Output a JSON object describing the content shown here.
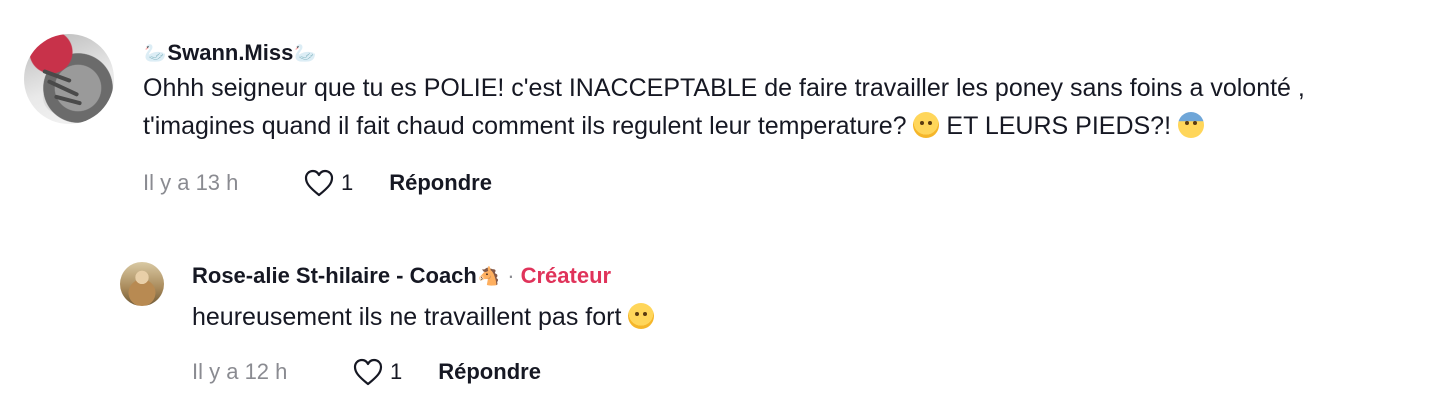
{
  "comments": [
    {
      "username": "Swann.Miss",
      "name_prefix_icon": "swan-icon",
      "name_suffix_icon": "swan-icon",
      "text_part1": "Ohhh seigneur que tu es POLIE! c'est INACCEPTABLE de faire travailler les poney sans foins a volonté , t'imagines quand il fait chaud comment ils regulent leur temperature? ",
      "emoji1": "pleading-face-emoji",
      "text_part2": " ET LEURS PIEDS?! ",
      "emoji2": "anxious-sweat-face-emoji",
      "time": "Il y a 13 h",
      "likes": "1",
      "reply_label": "Répondre"
    },
    {
      "username": "Rose-alie St-hilaire - Coach",
      "name_suffix_icon": "horse-icon",
      "separator": "·",
      "badge": "Créateur",
      "text": "heureusement ils ne travaillent pas fort ",
      "emoji": "smiling-face-emoji",
      "time": "Il y a 12 h",
      "likes": "1",
      "reply_label": "Répondre"
    }
  ],
  "colors": {
    "text": "#161823",
    "muted": "#8a8b91",
    "creator_badge": "#e0335a"
  }
}
